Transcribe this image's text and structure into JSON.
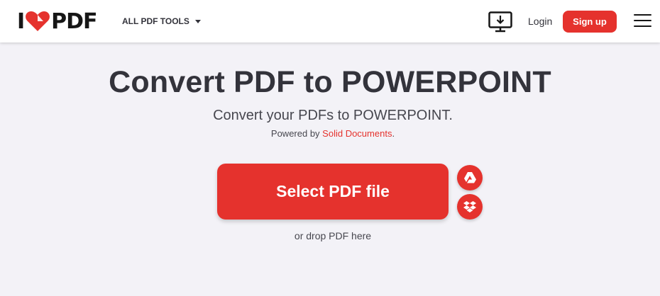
{
  "header": {
    "logo": {
      "left_text": "I",
      "right_text": "PDF",
      "heart_icon": "heart-icon"
    },
    "all_tools_label": "ALL PDF TOOLS",
    "desktop_icon": "desktop-download-icon",
    "login_label": "Login",
    "signup_label": "Sign up",
    "menu_icon": "hamburger-menu-icon"
  },
  "main": {
    "title": "Convert PDF to POWERPOINT",
    "subtitle": "Convert your PDFs to POWERPOINT.",
    "powered_prefix": "Powered by ",
    "powered_link": "Solid Documents",
    "powered_suffix": ".",
    "select_button_label": "Select PDF file",
    "drive_icon": "google-drive-icon",
    "dropbox_icon": "dropbox-icon",
    "drop_hint": "or drop PDF here"
  },
  "colors": {
    "accent": "#e5322d",
    "background": "#f3f2f7",
    "text": "#33333b"
  }
}
